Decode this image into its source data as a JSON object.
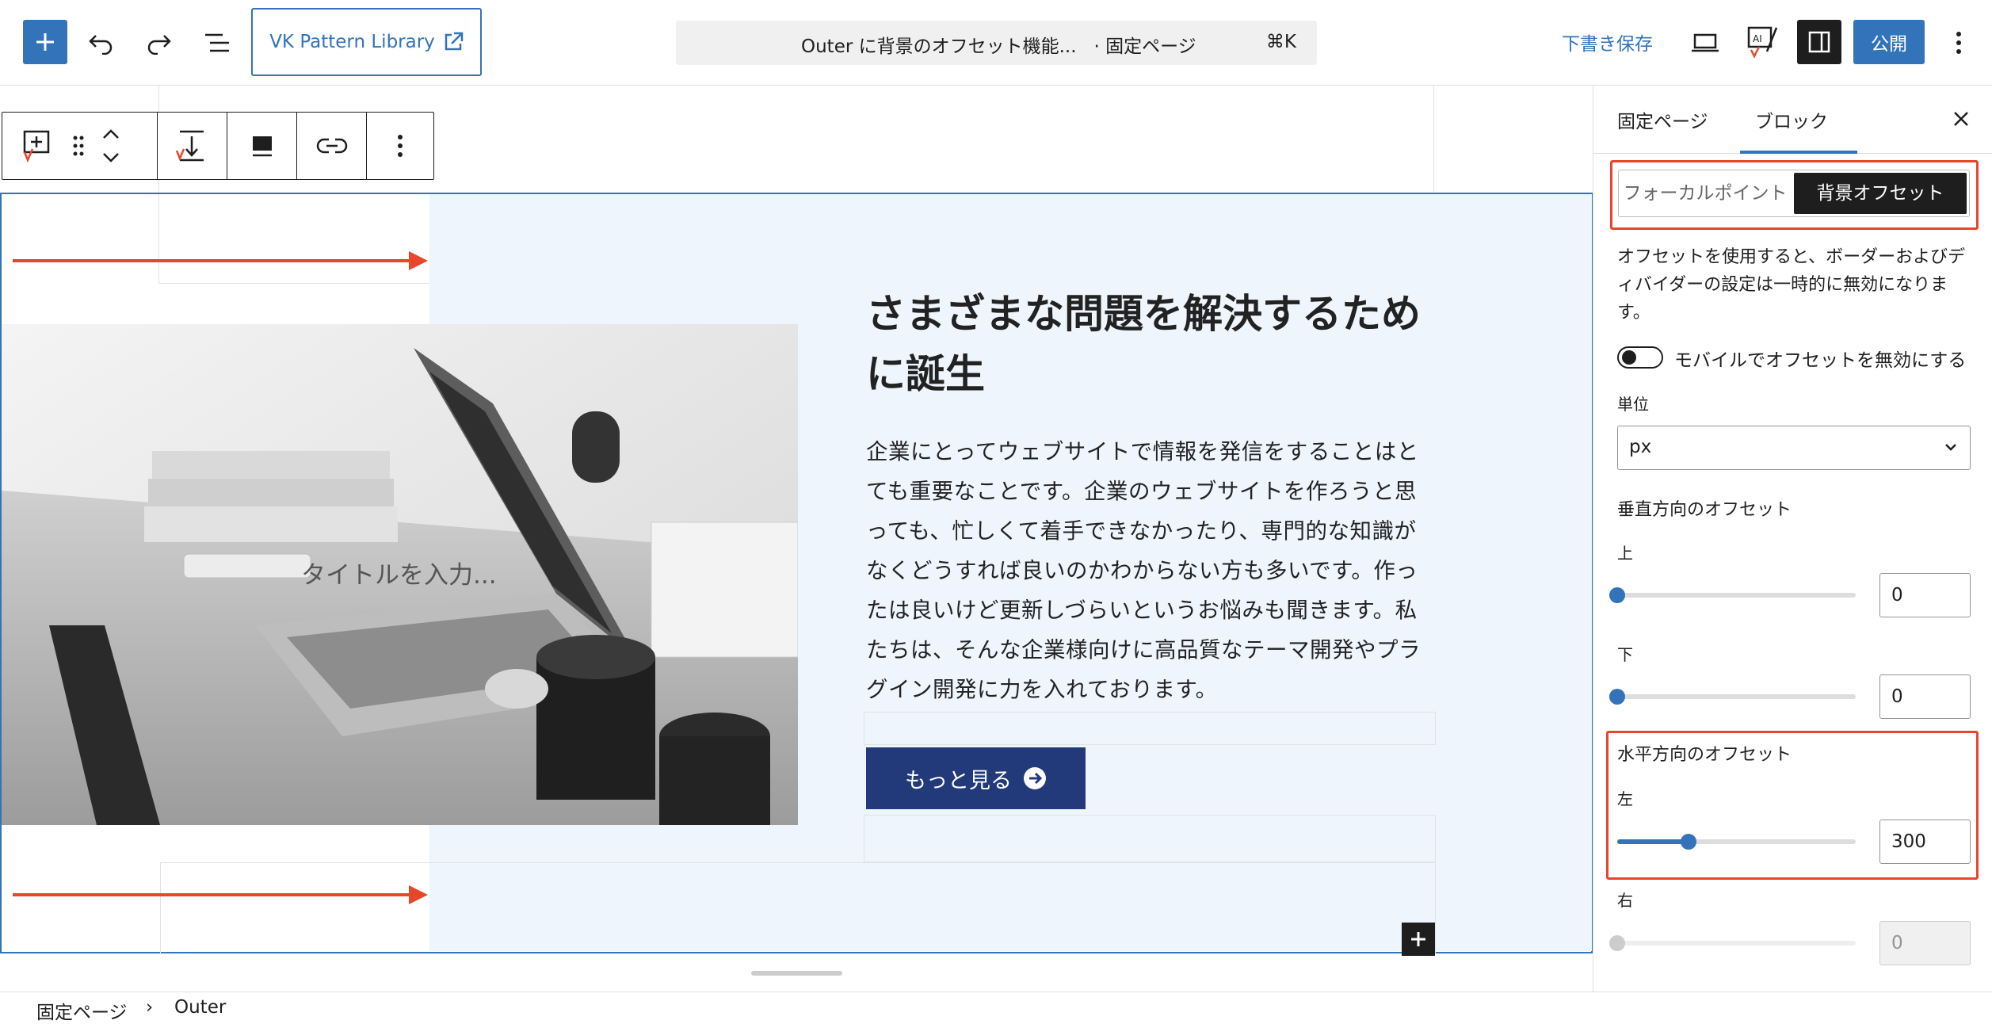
{
  "header": {
    "pattern_library_label": "VK Pattern Library",
    "command_title": "Outer に背景のオフセット機能...",
    "command_type": "· 固定ページ",
    "command_shortcut": "⌘K",
    "save_draft_label": "下書き保存",
    "publish_label": "公開"
  },
  "canvas": {
    "heading": "さまざまな問題を解決するために誕生",
    "body": "企業にとってウェブサイトで情報を発信をすることはとても重要なことです。企業のウェブサイトを作ろうと思っても、忙しくて着手できなかったり、専門的な知識がなくどうすれば良いのかわからない方も多いです。作ったは良いけど更新しづらいというお悩みも聞きます。私たちは、そんな企業様向けに高品質なテーマ開発やプラグイン開発に力を入れております。",
    "button_label": "もっと見る",
    "title_placeholder": "タイトルを入力..."
  },
  "sidebar": {
    "tab_page": "固定ページ",
    "tab_block": "ブロック",
    "segment_focal": "フォーカルポイント",
    "segment_offset": "背景オフセット",
    "description": "オフセットを使用すると、ボーダーおよびディバイダーの設定は一時的に無効になります。",
    "mobile_toggle_label": "モバイルでオフセットを無効にする",
    "unit_label": "単位",
    "unit_value": "px",
    "vertical_heading": "垂直方向のオフセット",
    "top_label": "上",
    "top_value": "0",
    "bottom_label": "下",
    "bottom_value": "0",
    "horizontal_heading": "水平方向のオフセット",
    "left_label": "左",
    "left_value": "300",
    "right_label": "右",
    "right_value": "0",
    "left_slider_fraction": 0.3
  },
  "footer": {
    "crumb_1": "固定ページ",
    "separator": "›",
    "crumb_2": "Outer"
  },
  "colors": {
    "accent": "#3373b9",
    "highlight": "#e8462b",
    "button": "#233a7a",
    "cover_bg": "#eef5fc"
  }
}
